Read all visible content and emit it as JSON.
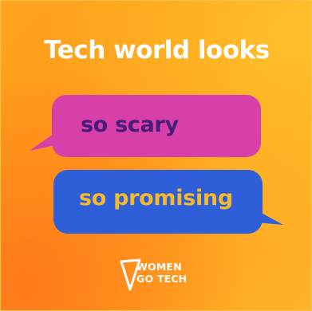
{
  "headline": "Tech world looks",
  "bubbles": [
    {
      "text": "so scary",
      "fill": "#d640a8",
      "text_color": "#4a1c7a"
    },
    {
      "text": "so promising",
      "fill": "#2f5fd8",
      "text_color": "#f6b92c"
    }
  ],
  "logo": {
    "line1": "WOMEN",
    "line2": "GO TECH",
    "mark_icon": "triangle-play-icon"
  },
  "colors": {
    "background_start": "#ffa31e",
    "background_end": "#ffb42a",
    "headline": "#ffffff"
  }
}
